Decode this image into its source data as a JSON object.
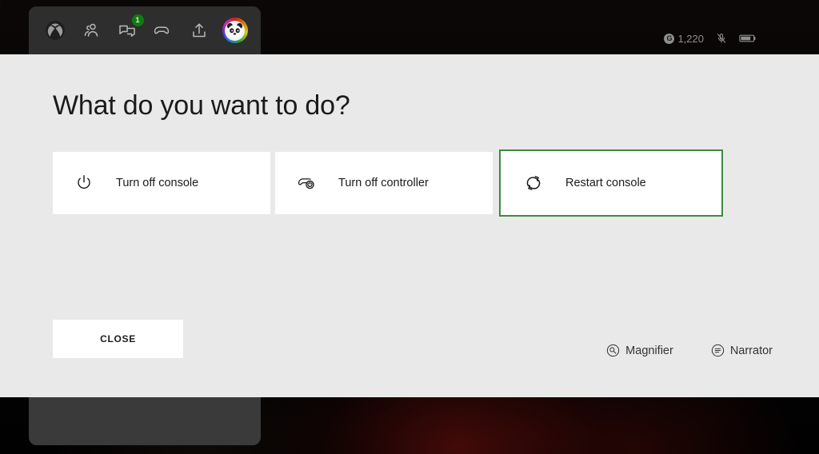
{
  "guide": {
    "nav_items": [
      {
        "name": "xbox-home-icon",
        "label": "Xbox",
        "badge": null
      },
      {
        "name": "people-icon",
        "label": "People",
        "badge": null
      },
      {
        "name": "messages-icon",
        "label": "Messages",
        "badge": "1"
      },
      {
        "name": "game-controller-icon",
        "label": "Games",
        "badge": null
      },
      {
        "name": "share-icon",
        "label": "Capture",
        "badge": null
      },
      {
        "name": "profile-avatar",
        "label": "Profile",
        "badge": null
      }
    ]
  },
  "status": {
    "gamerscore_badge": "G",
    "gamerscore": "1,220",
    "mic_icon_label": "microphone-muted",
    "battery_icon_label": "battery"
  },
  "dialog": {
    "title": "What do you want to do?",
    "options": [
      {
        "icon": "power-icon",
        "label": "Turn off console",
        "focused": false
      },
      {
        "icon": "controller-power-icon",
        "label": "Turn off controller",
        "focused": false
      },
      {
        "icon": "restart-icon",
        "label": "Restart console",
        "focused": true
      }
    ],
    "close_label": "CLOSE",
    "accessibility": [
      {
        "icon": "magnifier-icon",
        "label": "Magnifier"
      },
      {
        "icon": "narrator-icon",
        "label": "Narrator"
      }
    ]
  },
  "colors": {
    "dialog_background": "#e9e9e9",
    "card_background": "#ffffff",
    "focus_green": "#3e8a3e",
    "badge_green": "#107c10",
    "text_primary": "#1b1b1b",
    "guide_panel": "#3a3a3a"
  }
}
